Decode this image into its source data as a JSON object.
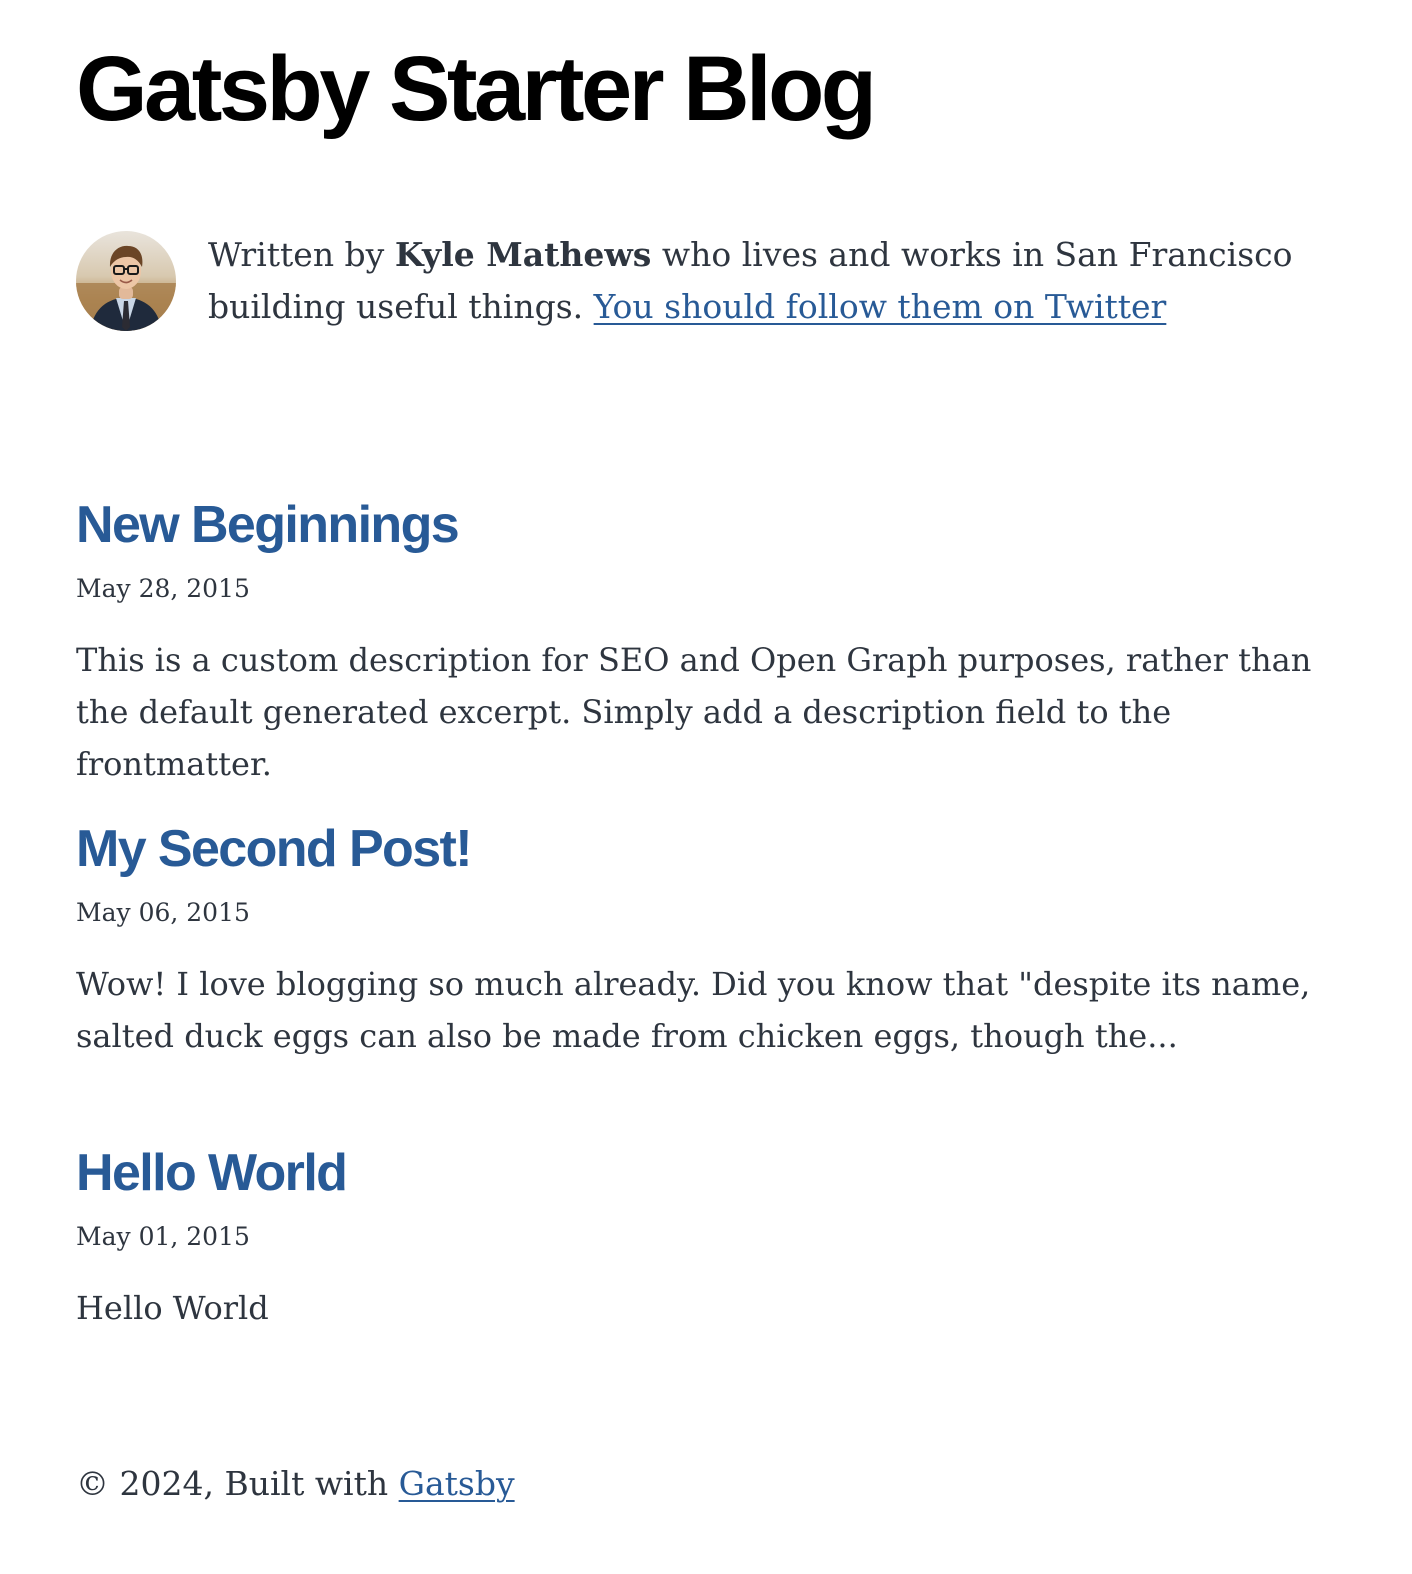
{
  "site": {
    "title": "Gatsby Starter Blog"
  },
  "bio": {
    "avatar_icon": "author-photo",
    "prefix": "Written by ",
    "author": "Kyle Mathews",
    "suffix": " who lives and works in San Francisco building useful things. ",
    "twitter_link": "You should follow them on Twitter"
  },
  "posts": [
    {
      "title": "New Beginnings",
      "date": "May 28, 2015",
      "description": "This is a custom description for SEO and Open Graph purposes, rather than the default generated excerpt. Simply add a description field to the frontmatter."
    },
    {
      "title": "My Second Post!",
      "date": "May 06, 2015",
      "description": "Wow! I love blogging so much already. Did you know that \"despite its name, salted duck eggs can also be made from chicken eggs, though the..."
    },
    {
      "title": "Hello World",
      "date": "May 01, 2015",
      "description": "Hello World"
    }
  ],
  "footer": {
    "prefix": "© 2024, Built with ",
    "link": "Gatsby"
  },
  "colors": {
    "link": "#285a96",
    "text": "#2e353f",
    "heading": "#000000",
    "background": "#ffffff"
  }
}
